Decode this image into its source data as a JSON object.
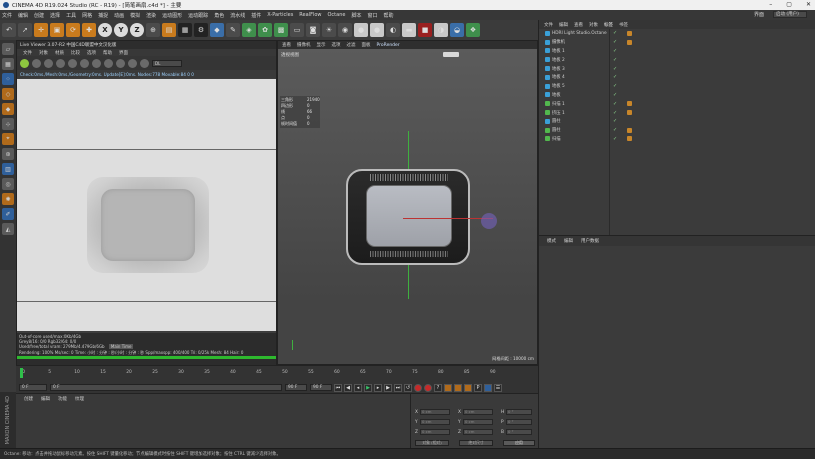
{
  "window": {
    "title": "CINEMA 4D R19.024 Studio (RC - R19) - [简笔画扇.c4d *] - 主要"
  },
  "menubar": {
    "items": [
      "文件",
      "编辑",
      "创建",
      "选择",
      "工具",
      "网格",
      "捕捉",
      "动画",
      "模拟",
      "渲染",
      "运动图形",
      "运动跟踪",
      "角色",
      "流水线",
      "插件",
      "X-Particles",
      "RealFlow",
      "Octane",
      "脚本",
      "窗口",
      "帮助"
    ],
    "layout_label": "界面",
    "layout_value": "启动 (用户)"
  },
  "toolbar": {
    "undo_icon": "↶",
    "axis_x": "X",
    "axis_y": "Y",
    "axis_z": "Z"
  },
  "live_viewer": {
    "title": "Live Viewer 3.07-R2 中国C4D联盟中文汉化版",
    "menu": [
      "文件",
      "对象",
      "材质",
      "比较",
      "选项",
      "帮助",
      "界面"
    ],
    "mode_select": "DL",
    "status_line": "Check:0ms./Mesh:0ms./Geometry:0ms. Update[E]:0ms. Nodes:778 Movable:84  0 0",
    "info_lines": [
      "Out-of-core used/max:0Kb/4Gb",
      "Grey8/16: 0/0        Rgb32/64: 0/0",
      "Used/free/total vram: 279Mb/4.479Gb/6Gb"
    ],
    "info_badge": "Main Time",
    "render_line": "Rendering: 100%   Ms/sec: 0   Time: 小时 : 分钟 : 秒/小时 : 分钟 : 秒   Spp/maxspp: 400/400   Tri: 0/25k   Mesh: 84   Hair: 0"
  },
  "viewport": {
    "menu": [
      "查看",
      "摄像机",
      "显示",
      "选项",
      "过滤",
      "面板"
    ],
    "prorender": "ProRender",
    "label": "透视视图",
    "stats": [
      {
        "k": "三角形",
        "v": "21940"
      },
      {
        "k": "四边形",
        "v": "0"
      },
      {
        "k": "线",
        "v": "66"
      },
      {
        "k": "点",
        "v": "0"
      },
      {
        "k": "帧时间值",
        "v": "0"
      }
    ],
    "grid_spacing": "网格间距 : 10000 cm"
  },
  "object_manager": {
    "menu": [
      "文件",
      "编辑",
      "查看",
      "对象",
      "标签",
      "书签"
    ],
    "active_tab": "标签",
    "items": [
      {
        "name": "HDRI Light Studio.Octane",
        "icon": "b",
        "tag": true
      },
      {
        "name": "摄像机",
        "icon": "b",
        "tag": true
      },
      {
        "name": "地板 1",
        "icon": "b",
        "tag": false
      },
      {
        "name": "地板 2",
        "icon": "b",
        "tag": false
      },
      {
        "name": "地板 3",
        "icon": "b",
        "tag": false
      },
      {
        "name": "地板 4",
        "icon": "b",
        "tag": false
      },
      {
        "name": "地板 5",
        "icon": "b",
        "tag": false
      },
      {
        "name": "地板",
        "icon": "b",
        "tag": false
      },
      {
        "name": "扫描 1",
        "icon": "g",
        "tag": true
      },
      {
        "name": "挤压 1",
        "icon": "g",
        "tag": true
      },
      {
        "name": "圆柱",
        "icon": "b",
        "tag": false
      },
      {
        "name": "圆柱",
        "icon": "g",
        "tag": true
      },
      {
        "name": "扫描",
        "icon": "g",
        "tag": true
      }
    ]
  },
  "attribute_manager": {
    "menu": [
      "模式",
      "编辑",
      "用户数据"
    ]
  },
  "timeline": {
    "ticks": [
      "0",
      "5",
      "10",
      "15",
      "20",
      "25",
      "30",
      "35",
      "40",
      "45",
      "50",
      "55",
      "60",
      "65",
      "70",
      "75",
      "80",
      "85",
      "90"
    ],
    "tick_pct": [
      0.5,
      6.2,
      11.9,
      17.6,
      23.3,
      29.0,
      34.7,
      40.4,
      46.1,
      51.8,
      57.5,
      63.2,
      68.9,
      74.6,
      80.3,
      86.0,
      91.7,
      97.4,
      103.1
    ],
    "start_frame": "0 F",
    "end_frame": "90 F",
    "current_frame_right": "0 F",
    "current_field": "0 F",
    "range_field": "90 F",
    "playhead": 0
  },
  "material": {
    "menu": [
      "创建",
      "编辑",
      "功能",
      "纹理"
    ]
  },
  "coordinates": {
    "rows": [
      {
        "a": "X",
        "av": "0 cm",
        "b": "X",
        "bv": "0 cm",
        "c": "H",
        "cv": "0 °"
      },
      {
        "a": "Y",
        "av": "0 cm",
        "b": "Y",
        "bv": "0 cm",
        "c": "P",
        "cv": "0 °"
      },
      {
        "a": "Z",
        "av": "0 cm",
        "b": "Z",
        "bv": "0 cm",
        "c": "B",
        "cv": "0 °"
      }
    ],
    "btn_object": "对象 (相对)",
    "btn_size": "绝对尺寸",
    "btn_apply": "应用"
  },
  "left_brand": "MAXON CINEMA 4D",
  "statusbar": {
    "text": "Octane:    移动：点击并拖动鼠标移动元素。按住 SHIFT 键量化移动；节点编辑模式时按住 SHIFT 键增加选择对象；按住 CTRL 键减少选择对象。"
  },
  "colors": {
    "accent": "#2fbf4a",
    "selection": "#456a8f",
    "axis_x": "#b33333",
    "axis_y": "#3fb03f"
  }
}
